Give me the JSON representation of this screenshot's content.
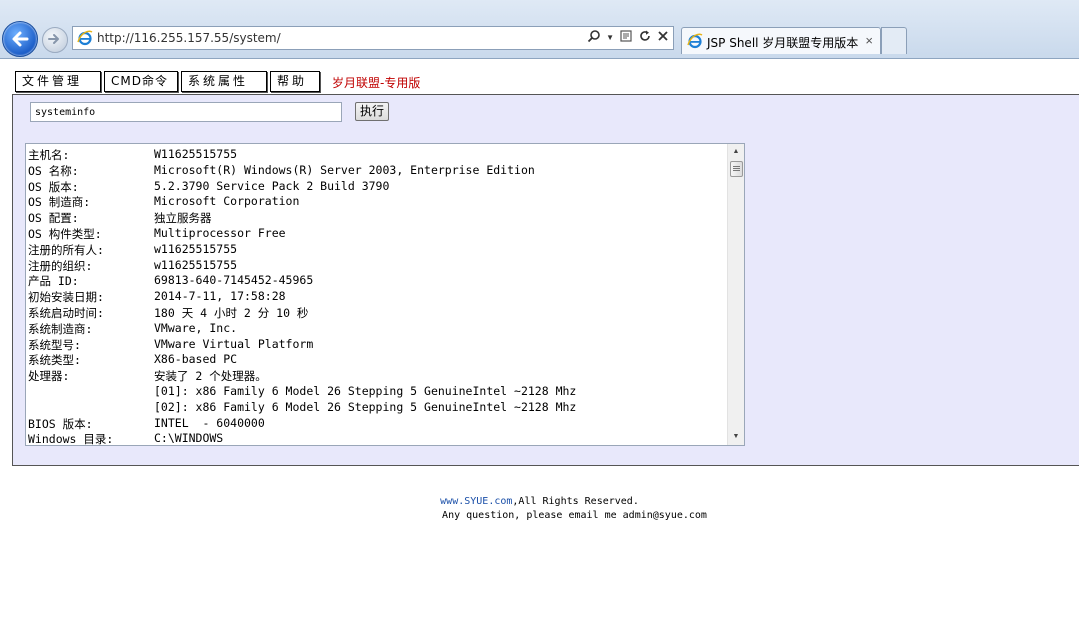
{
  "browser": {
    "url": "http://116.255.157.55/system/",
    "tab_title": "JSP Shell 岁月联盟专用版本",
    "tab_close": "×"
  },
  "menu": {
    "items": [
      "文件管理",
      "CMD命令",
      "系统属性",
      "帮助"
    ],
    "brand": "岁月联盟-专用版"
  },
  "command": {
    "value": "systeminfo",
    "exec_label": "执行"
  },
  "output": {
    "lines": [
      {
        "key": "主机名:",
        "value": "W11625515755"
      },
      {
        "key": "OS 名称:",
        "value": "Microsoft(R) Windows(R) Server 2003, Enterprise Edition"
      },
      {
        "key": "OS 版本:",
        "value": "5.2.3790 Service Pack 2 Build 3790"
      },
      {
        "key": "OS 制造商:",
        "value": "Microsoft Corporation"
      },
      {
        "key": "OS 配置:",
        "value": "独立服务器"
      },
      {
        "key": "OS 构件类型:",
        "value": "Multiprocessor Free"
      },
      {
        "key": "注册的所有人:",
        "value": "w11625515755"
      },
      {
        "key": "注册的组织:",
        "value": "w11625515755"
      },
      {
        "key": "产品 ID:",
        "value": "69813-640-7145452-45965"
      },
      {
        "key": "初始安装日期:",
        "value": "2014-7-11, 17:58:28"
      },
      {
        "key": "系统启动时间:",
        "value": "180 天 4 小时 2 分 10 秒"
      },
      {
        "key": "系统制造商:",
        "value": "VMware, Inc."
      },
      {
        "key": "系统型号:",
        "value": "VMware Virtual Platform"
      },
      {
        "key": "系统类型:",
        "value": "X86-based PC"
      },
      {
        "key": "处理器:",
        "value": "安装了 2 个处理器。"
      },
      {
        "key": "",
        "value": "[01]: x86 Family 6 Model 26 Stepping 5 GenuineIntel ~2128 Mhz"
      },
      {
        "key": "",
        "value": "[02]: x86 Family 6 Model 26 Stepping 5 GenuineIntel ~2128 Mhz"
      },
      {
        "key": "BIOS 版本:",
        "value": "INTEL  - 6040000"
      },
      {
        "key": "Windows 目录:",
        "value": "C:\\WINDOWS"
      }
    ]
  },
  "footer": {
    "site_link": "www.SYUE.com",
    "rights": ",All Rights Reserved.",
    "contact": "Any question, please email me admin@syue.com"
  },
  "colors": {
    "panel_bg": "#e8e8fb",
    "brand_red": "#c00000",
    "link_blue": "#1a4fa8"
  },
  "icons": {
    "back": "back-arrow-icon",
    "forward": "forward-arrow-icon",
    "ie": "ie-logo-icon",
    "search": "search-icon",
    "compat": "compatibility-view-icon",
    "refresh": "refresh-icon",
    "stop": "stop-icon"
  }
}
